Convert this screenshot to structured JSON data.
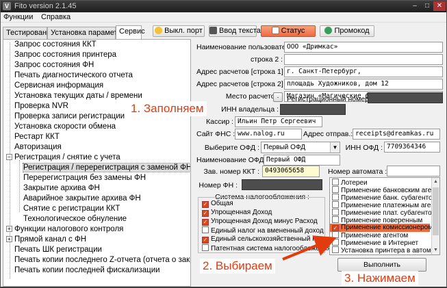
{
  "window": {
    "title": "Fito version 2.1.45",
    "controls": {
      "minimize": "–",
      "maximize": "□",
      "close": "✕"
    }
  },
  "menu": [
    "Функции",
    "Справка"
  ],
  "tabs": [
    {
      "label": "Тестирование",
      "active": false
    },
    {
      "label": "Установка параметров",
      "active": false
    },
    {
      "label": "Сервис",
      "active": true
    }
  ],
  "toolbar": {
    "port_button": "Выкл. порт",
    "text_input_button": "Ввод текста",
    "status_button": "Статус",
    "promo_button": "Промокод"
  },
  "tree": [
    {
      "label": "Запрос состояния ККТ",
      "expander": ""
    },
    {
      "label": "Запрос состояния принтера",
      "expander": ""
    },
    {
      "label": "Запрос состояния ФН",
      "expander": ""
    },
    {
      "label": "Печать диагностического отчета",
      "expander": ""
    },
    {
      "label": "Сервисная информация",
      "expander": ""
    },
    {
      "label": "Установка текущих даты / времени",
      "expander": ""
    },
    {
      "label": "Проверка NVR",
      "expander": ""
    },
    {
      "label": "Проверка записи регистрации",
      "expander": ""
    },
    {
      "label": "Установка скорости обмена",
      "expander": ""
    },
    {
      "label": "Рестарт ККТ",
      "expander": ""
    },
    {
      "label": "Авторизация",
      "expander": ""
    },
    {
      "label": "Регистрация / снятие с учета",
      "expander": "−"
    },
    {
      "label": "Регистрация / перерегистрация с заменой ФН",
      "expander": "",
      "child": true,
      "selected": true
    },
    {
      "label": "Перерегистрация без замены ФН",
      "expander": "",
      "child": true
    },
    {
      "label": "Закрытие архива ФН",
      "expander": "",
      "child": true
    },
    {
      "label": "Аварийное закрытие архива ФН",
      "expander": "",
      "child": true
    },
    {
      "label": "Снятие с регистрации ККТ",
      "expander": "",
      "child": true
    },
    {
      "label": "Технологическое обнуление",
      "expander": "",
      "child": true
    },
    {
      "label": "Функции налогового контроля",
      "expander": "+"
    },
    {
      "label": "Прямой канал с ФН",
      "expander": "+"
    },
    {
      "label": "Печать ШК регистрации",
      "expander": ""
    },
    {
      "label": "Печать копии последнего Z-отчета (отчета о закры",
      "expander": ""
    },
    {
      "label": "Печать копии последней фискализации",
      "expander": ""
    }
  ],
  "form": {
    "user_name": {
      "label": "Наименование пользователя :",
      "value": "ООО «Дримкас»"
    },
    "line2": {
      "label": "строка 2 :",
      "value": ""
    },
    "address1": {
      "label": "Адрес расчетов [строка 1] :",
      "value": "г. Санкт-Петербург,"
    },
    "address2": {
      "label": "Адрес расчетов [строка 2] :",
      "value": "площадь Художников, дом 12"
    },
    "place": {
      "label": "Место расчетов :",
      "value": "Магазин «Магические фокусы»"
    },
    "reg_number": {
      "label": "Регистрационный номер :",
      "button": ".",
      "value": ""
    },
    "inn_owner": {
      "label": "ИНН владельца :",
      "value": ""
    },
    "cashier": {
      "label": "Кассир :",
      "value": "Ильин Петр Сергеевич"
    },
    "fns_site": {
      "label": "Сайт ФНС :",
      "value": "www.nalog.ru"
    },
    "sender_address": {
      "label": "Адрес отправ.:",
      "value": "receipts@dreamkas.ru"
    },
    "ofd_select": {
      "label": "Выберите ОФД :",
      "value": "Первый ОФД"
    },
    "ofd_inn": {
      "label": "ИНН ОФД :",
      "value": "7709364346"
    },
    "ofd_name": {
      "label": "Наименование ОФД :",
      "value": "Первый ОФД"
    },
    "kkt_serial": {
      "label": "Зав. номер ККТ :",
      "value": "0493065658"
    },
    "automat_number": {
      "label": "Номер автомата :",
      "value": ""
    },
    "fn_number": {
      "label": "Номер ФН :",
      "value": ""
    }
  },
  "tax_systems": {
    "title": "Система налогообложения :",
    "items": [
      {
        "label": "Общая",
        "checked": true
      },
      {
        "label": "Упрощенная Доход",
        "checked": true
      },
      {
        "label": "Упрощенная Доход минус Расход",
        "checked": true
      },
      {
        "label": "Единый налог на вмененный доход",
        "checked": false
      },
      {
        "label": "Единый сельскохозяйственный налог",
        "checked": true
      },
      {
        "label": "Патентная система налогообложения",
        "checked": false
      }
    ]
  },
  "modes_list": [
    {
      "label": "Лотереи",
      "checked": false
    },
    {
      "label": "Применение банковским агентом",
      "checked": false
    },
    {
      "label": "Применение банк. субагентом",
      "checked": false
    },
    {
      "label": "Применение платежным агентом",
      "checked": false
    },
    {
      "label": "Применение плат. субагентом",
      "checked": false
    },
    {
      "label": "Применение поверенным",
      "checked": false
    },
    {
      "label": "Применение комиссионером",
      "checked": true,
      "highlight": true
    },
    {
      "label": "Применение агентом",
      "checked": false
    },
    {
      "label": "Применение в Интернет",
      "checked": false
    },
    {
      "label": "Установка принтера в автомате",
      "checked": false
    }
  ],
  "execute_button": "Выполнить",
  "annotations": {
    "step1": "1. Заполняем",
    "step2": "2. Выбираем",
    "step3": "3. Нажимаем"
  },
  "colors": {
    "accent": "#e23b0e",
    "highlight": "#ee6a3a",
    "status_button": "#ec6b44"
  }
}
